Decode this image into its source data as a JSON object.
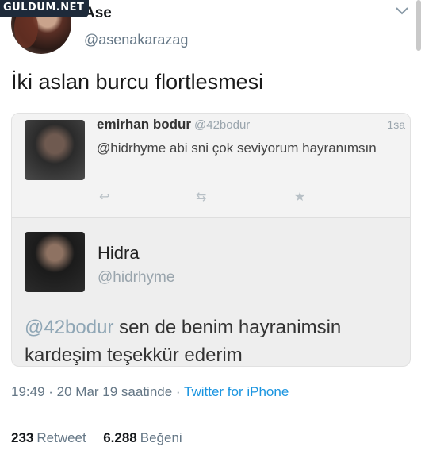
{
  "watermark": "GULDUM.NET",
  "author": {
    "name": "Ase",
    "handle": "@asenakarazag"
  },
  "tweet": {
    "text": "İki aslan burcu flortlesmesi"
  },
  "embedded": {
    "first": {
      "name": "emirhan bodur",
      "handle": "@42bodur",
      "time": "1sa",
      "text": "@hidrhyme  abi sni çok seviyorum hayranımsın",
      "actions": [
        "reply-icon",
        "retweet-icon",
        "favorite-icon"
      ]
    },
    "second": {
      "name": "Hidra",
      "handle": "@hidrhyme",
      "mention": "@42bodur",
      "text": " sen de benim hayranimsin kardeşim teşekkür ederim"
    }
  },
  "meta": {
    "time": "19:49 · 20 Mar 19 saatinde · ",
    "source": "Twitter for iPhone"
  },
  "stats": {
    "retweets_count": "233",
    "retweets_label": "Retweet",
    "likes_count": "6.288",
    "likes_label": "Beğeni"
  }
}
